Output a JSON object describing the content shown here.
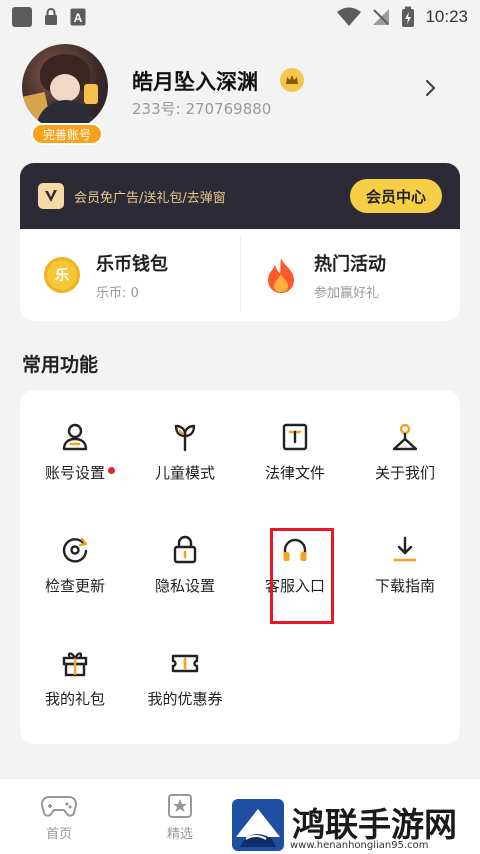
{
  "status_bar": {
    "time": "10:23"
  },
  "profile": {
    "username": "皓月坠入深渊",
    "uid": "233号: 270769880",
    "badge": "完善账号"
  },
  "vip": {
    "text": "会员免广告/送礼包/去弹窗",
    "button": "会员中心"
  },
  "wallet": {
    "coin_icon_text": "乐",
    "title": "乐币钱包",
    "subtitle": "乐币: 0"
  },
  "activity": {
    "title": "热门活动",
    "subtitle": "参加赢好礼"
  },
  "functions": {
    "section_title": "常用功能",
    "items": [
      {
        "label": "账号设置",
        "icon": "user-icon",
        "has_dot": true
      },
      {
        "label": "儿童模式",
        "icon": "sprout-icon"
      },
      {
        "label": "法律文件",
        "icon": "document-icon"
      },
      {
        "label": "关于我们",
        "icon": "info-person-icon"
      },
      {
        "label": "检查更新",
        "icon": "refresh-icon"
      },
      {
        "label": "隐私设置",
        "icon": "lock-icon"
      },
      {
        "label": "客服入口",
        "icon": "headphones-icon",
        "highlighted": true
      },
      {
        "label": "下载指南",
        "icon": "download-icon"
      },
      {
        "label": "我的礼包",
        "icon": "gift-icon"
      },
      {
        "label": "我的优惠券",
        "icon": "coupon-icon"
      }
    ]
  },
  "tab_bar": {
    "tabs": [
      {
        "label": "首页",
        "icon": "gamepad-icon"
      },
      {
        "label": "精选",
        "icon": "star-badge-icon"
      }
    ]
  },
  "watermark": {
    "title": "鸿联手游网",
    "url": "www.henanhonglian95.com"
  },
  "colors": {
    "accent": "#f7cf46",
    "orange": "#f7a21b",
    "vip_bg": "#2c2a34",
    "highlight": "#e31b25"
  }
}
